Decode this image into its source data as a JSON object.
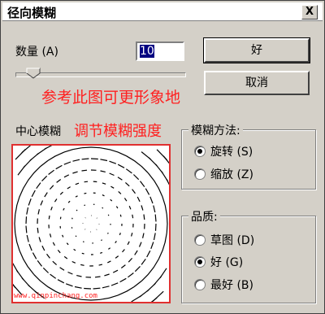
{
  "window": {
    "title": "径向模糊",
    "close_glyph": "X"
  },
  "amount": {
    "label": "数量 (A)",
    "value": "10"
  },
  "buttons": {
    "ok": "好",
    "cancel": "取消"
  },
  "annotations": {
    "refer": "参考此图可更形象地",
    "adjust": "调节模糊强度",
    "url": "www.qinpinchang.com"
  },
  "center": {
    "label": "中心模糊"
  },
  "method": {
    "legend": "模糊方法:",
    "options": [
      {
        "label": "旋转 (S)",
        "checked": true
      },
      {
        "label": "缩放 (Z)",
        "checked": false
      }
    ]
  },
  "quality": {
    "legend": "品质:",
    "options": [
      {
        "label": "草图 (D)",
        "checked": false
      },
      {
        "label": "好 (G)",
        "checked": true
      },
      {
        "label": "最好 (B)",
        "checked": false
      }
    ]
  },
  "colors": {
    "annotation": "#ff2020",
    "selection": "#000080"
  }
}
